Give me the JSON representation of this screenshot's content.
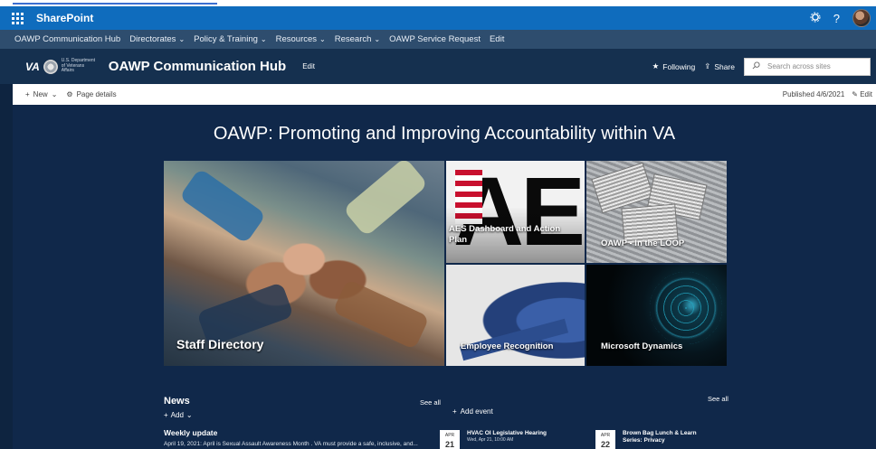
{
  "suite": {
    "brand": "SharePoint",
    "settings_icon": "gear-icon",
    "help_label": "?"
  },
  "hubnav": {
    "items": [
      {
        "label": "OAWP Communication Hub",
        "has_chevron": false
      },
      {
        "label": "Directorates",
        "has_chevron": true
      },
      {
        "label": "Policy & Training",
        "has_chevron": true
      },
      {
        "label": "Resources",
        "has_chevron": true
      },
      {
        "label": "Research",
        "has_chevron": true
      },
      {
        "label": "OAWP Service Request",
        "has_chevron": false
      },
      {
        "label": "Edit",
        "has_chevron": false
      }
    ]
  },
  "site": {
    "logo_text": "VA",
    "dept_text": "U.S. Department of Veterans Affairs",
    "title": "OAWP Communication Hub",
    "edit_label": "Edit",
    "following_label": "Following",
    "share_label": "Share",
    "search_placeholder": "Search across sites"
  },
  "commandbar": {
    "new_label": "New",
    "page_details_label": "Page details",
    "published_label": "Published 4/6/2021",
    "edit_label": "Edit"
  },
  "hero": {
    "title": "OAWP: Promoting and Improving Accountability within VA",
    "tiles": {
      "staff": "Staff Directory",
      "aes": "AES Dashboard and Action Plan",
      "loop": "OAWP - In the LOOP",
      "recognition": "Employee Recognition",
      "dynamics": "Microsoft Dynamics"
    },
    "aes_logo_text": "AES"
  },
  "news": {
    "title": "News",
    "see_all": "See all",
    "add_label": "Add",
    "item_title": "Weekly update",
    "item_desc": "April 19, 2021: April is Sexual Assault Awareness Month . VA must provide a safe, inclusive, and..."
  },
  "events": {
    "add_label": "Add event",
    "see_all": "See all",
    "items": [
      {
        "month": "APR",
        "day": "21",
        "title": "HVAC OI Legislative Hearing",
        "time": "Wed, Apr 21, 10:00 AM"
      },
      {
        "month": "APR",
        "day": "22",
        "title": "Brown Bag Lunch & Learn Series: Privacy",
        "time": ""
      }
    ]
  },
  "colors": {
    "suite_blue": "#0f6cbd",
    "page_navy": "#10284a",
    "hubnav": "#2e4d6e"
  }
}
